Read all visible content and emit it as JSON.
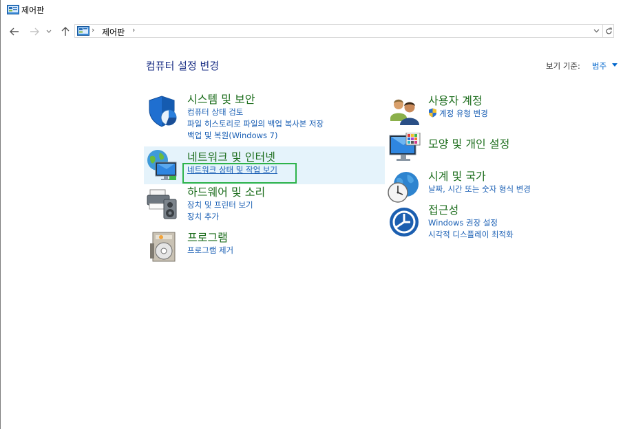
{
  "window": {
    "title": "제어판"
  },
  "address": {
    "crumb": "제어판"
  },
  "content": {
    "heading": "컴퓨터 설정 변경",
    "view_by_label": "보기 기준:",
    "view_by_value": "범주"
  },
  "left_categories": [
    {
      "title": "시스템 및 보안",
      "icon": "shield-icon",
      "links": [
        "컴퓨터 상태 검토",
        "파일 히스토리로 파일의 백업 복사본 저장",
        "백업 및 복원(Windows 7)"
      ]
    },
    {
      "title": "네트워크 및 인터넷",
      "icon": "network-globe-icon",
      "links": [
        "네트워크 상태 및 작업 보기"
      ]
    },
    {
      "title": "하드웨어 및 소리",
      "icon": "printer-speaker-icon",
      "links": [
        "장치 및 프린터 보기",
        "장치 추가"
      ]
    },
    {
      "title": "프로그램",
      "icon": "programs-disc-icon",
      "links": [
        "프로그램 제거"
      ]
    }
  ],
  "right_categories": [
    {
      "title": "사용자 계정",
      "icon": "users-icon",
      "links": [
        "계정 유형 변경"
      ]
    },
    {
      "title": "모양 및 개인 설정",
      "icon": "monitor-palette-icon",
      "links": []
    },
    {
      "title": "시계 및 국가",
      "icon": "clock-globe-icon",
      "links": [
        "날짜, 시간 또는 숫자 형식 변경"
      ]
    },
    {
      "title": "접근성",
      "icon": "accessibility-icon",
      "links": [
        "Windows 권장 설정",
        "시각적 디스플레이 최적화"
      ]
    }
  ],
  "colors": {
    "category_title": "#1e6e1e",
    "link": "#1a5fb4",
    "heading": "#1e3287",
    "hover_row": "#e5f3fb",
    "focus_box": "#2db34a"
  }
}
